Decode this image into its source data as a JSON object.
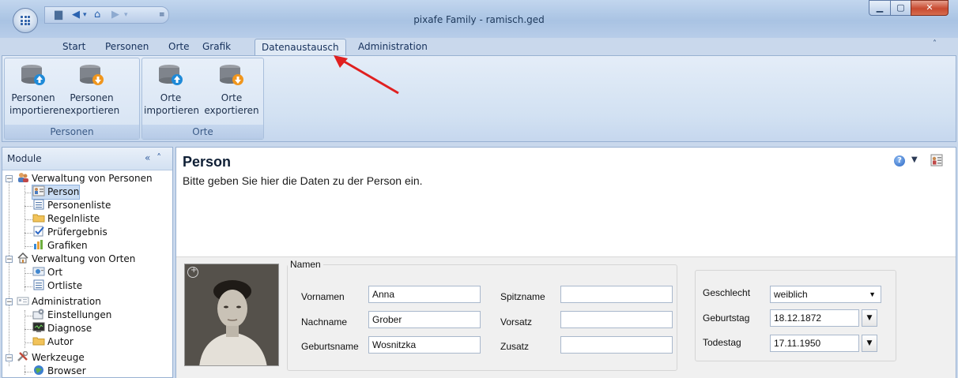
{
  "window": {
    "title": "pixafe Family - ramisch.ged",
    "controls": [
      "minimize",
      "maximize",
      "close"
    ]
  },
  "quick_access": {
    "icons": [
      "save-icon",
      "back-icon",
      "dropdown-icon",
      "home-icon",
      "forward-icon",
      "dropdown-icon",
      "customize-icon"
    ]
  },
  "tabs": [
    {
      "label": "Start",
      "active": false
    },
    {
      "label": "Personen",
      "active": false
    },
    {
      "label": "Orte",
      "active": false
    },
    {
      "label": "Grafik",
      "active": false
    },
    {
      "label": "Datenaustausch",
      "active": true
    },
    {
      "label": "Administration",
      "active": false
    }
  ],
  "ribbon": {
    "groups": [
      {
        "label": "Personen",
        "buttons": [
          {
            "line1": "Personen",
            "line2": "importieren",
            "icon": "database-import-icon"
          },
          {
            "line1": "Personen",
            "line2": "exportieren",
            "icon": "database-export-icon"
          }
        ]
      },
      {
        "label": "Orte",
        "buttons": [
          {
            "line1": "Orte",
            "line2": "importieren",
            "icon": "database-import-icon"
          },
          {
            "line1": "Orte",
            "line2": "exportieren",
            "icon": "database-export-icon"
          }
        ]
      }
    ]
  },
  "sidebar": {
    "title": "Module",
    "controls": "« ˄",
    "tree": [
      {
        "label": "Verwaltung von Personen",
        "level": 0,
        "icon": "people-icon",
        "expanded": true
      },
      {
        "label": "Person",
        "level": 1,
        "icon": "person-card-icon",
        "selected": true
      },
      {
        "label": "Personenliste",
        "level": 1,
        "icon": "list-icon"
      },
      {
        "label": "Regelnliste",
        "level": 1,
        "icon": "folder-icon"
      },
      {
        "label": "Prüfergebnis",
        "level": 1,
        "icon": "checkmark-icon"
      },
      {
        "label": "Grafiken",
        "level": 1,
        "icon": "chart-icon"
      },
      {
        "label": "Verwaltung von Orten",
        "level": 0,
        "icon": "house-icon",
        "expanded": true
      },
      {
        "label": "Ort",
        "level": 1,
        "icon": "place-icon"
      },
      {
        "label": "Ortliste",
        "level": 1,
        "icon": "list-icon"
      },
      {
        "label": "Administration",
        "level": 0,
        "icon": "admin-icon",
        "expanded": true
      },
      {
        "label": "Einstellungen",
        "level": 1,
        "icon": "settings-icon"
      },
      {
        "label": "Diagnose",
        "level": 1,
        "icon": "monitor-icon"
      },
      {
        "label": "Autor",
        "level": 1,
        "icon": "folder-icon"
      },
      {
        "label": "Werkzeuge",
        "level": 0,
        "icon": "tools-icon",
        "expanded": true
      },
      {
        "label": "Browser",
        "level": 1,
        "icon": "globe-icon"
      }
    ]
  },
  "main": {
    "title": "Person",
    "subtitle": "Bitte geben Sie hier die Daten zu der Person ein.",
    "names_group": {
      "legend": "Namen",
      "fields": [
        {
          "label": "Vornamen",
          "value": "Anna"
        },
        {
          "label": "Nachname",
          "value": "Grober"
        },
        {
          "label": "Geburtsname",
          "value": "Wosnitzka"
        },
        {
          "label": "Spitzname",
          "value": ""
        },
        {
          "label": "Vorsatz",
          "value": ""
        },
        {
          "label": "Zusatz",
          "value": ""
        }
      ]
    },
    "details_group": {
      "geschlecht_label": "Geschlecht",
      "geschlecht_value": "weiblich",
      "geburtstag_label": "Geburtstag",
      "geburtstag_value": "18.12.1872",
      "todestag_label": "Todestag",
      "todestag_value": "17.11.1950"
    }
  },
  "colors": {
    "ribbon_bg": "#d2e1f2",
    "accent_blue": "#2a66c4",
    "annotation_arrow": "#e02020",
    "export_orange": "#f0961e",
    "import_blue": "#1f8ad8"
  }
}
